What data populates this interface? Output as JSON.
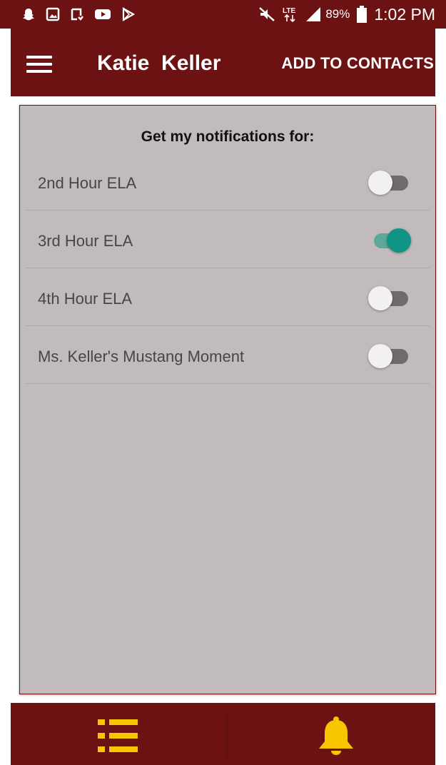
{
  "status_bar": {
    "battery": "89%",
    "time": "1:02 PM",
    "network": "LTE",
    "icons_left": [
      "snapchat-icon",
      "gallery-icon",
      "device-icon",
      "youtube-icon",
      "play-store-icon"
    ],
    "icons_right": [
      "mute-icon",
      "lte-icon",
      "signal-icon",
      "battery-icon"
    ]
  },
  "app_bar": {
    "title": "Katie  Keller",
    "action": "ADD TO CONTACTS"
  },
  "panel": {
    "title": "Get my notifications for:",
    "rows": [
      {
        "label": "2nd Hour ELA",
        "enabled": false
      },
      {
        "label": "3rd Hour ELA",
        "enabled": true
      },
      {
        "label": "4th Hour ELA",
        "enabled": false
      },
      {
        "label": "Ms. Keller's Mustang Moment",
        "enabled": false
      }
    ]
  },
  "bottom_nav": {
    "tabs": [
      {
        "icon": "list-icon"
      },
      {
        "icon": "bell-icon"
      }
    ]
  },
  "colors": {
    "primary": "#6d1212",
    "panel_bg": "#c1bbbb",
    "toggle_on": "#0f9486",
    "accent_yellow": "#f7c600"
  }
}
